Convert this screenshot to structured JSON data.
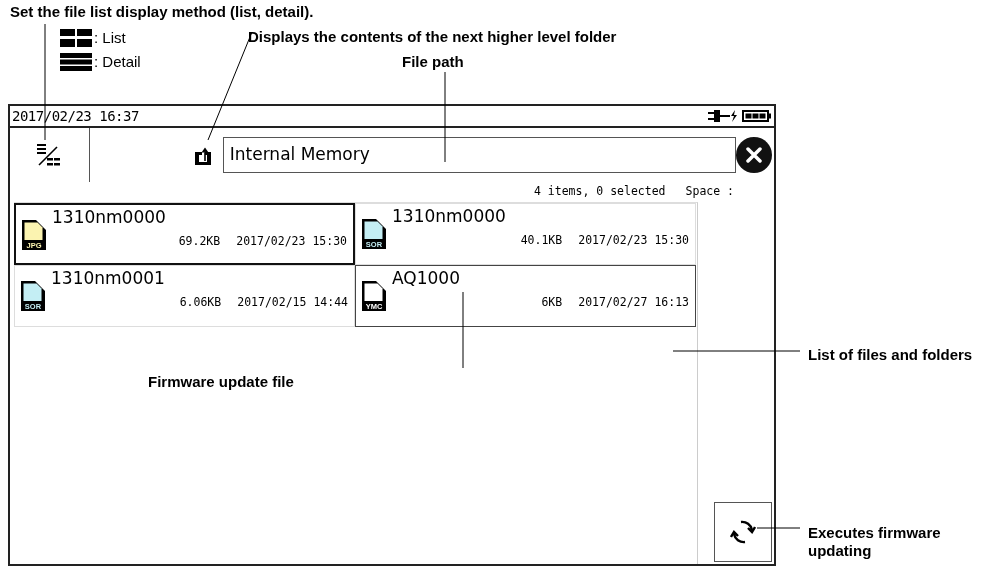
{
  "annotations": {
    "display_method": "Set the file list display method (list, detail).",
    "legend": [
      {
        "kind": "list",
        "label": ": List"
      },
      {
        "kind": "detail",
        "label": ": Detail"
      }
    ],
    "up_folder": "Displays the contents of the next higher level folder",
    "file_path": "File path",
    "firmware_file": "Firmware update file",
    "file_list": "List of files and folders",
    "execute": "Executes firmware updating"
  },
  "screen": {
    "datetime": "2017/02/23 16:37",
    "path": "Internal Memory",
    "summary": "4 items, 0 selected",
    "space_label": "Space :",
    "files": [
      {
        "name": "1310nm0000",
        "type": "JPG",
        "color": "#fbf3b0",
        "size": "69.2KB",
        "date": "2017/02/23 15:30",
        "focused": true,
        "outlined": false
      },
      {
        "name": "1310nm0000",
        "type": "SOR",
        "color": "#c4eef4",
        "size": "40.1KB",
        "date": "2017/02/23 15:30",
        "focused": false,
        "outlined": false
      },
      {
        "name": "1310nm0001",
        "type": "SOR",
        "color": "#c4eef4",
        "size": "6.06KB",
        "date": "2017/02/15 14:44",
        "focused": false,
        "outlined": false
      },
      {
        "name": "AQ1000",
        "type": "YMC",
        "color": "#ffffff",
        "size": "6KB",
        "date": "2017/02/27 16:13",
        "focused": false,
        "outlined": true
      }
    ]
  }
}
